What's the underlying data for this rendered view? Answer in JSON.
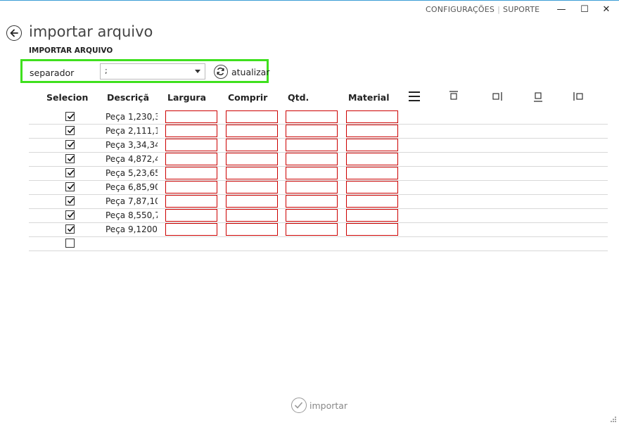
{
  "topnav": {
    "settings": "CONFIGURAÇÕES",
    "support": "SUPORTE",
    "separator": "|"
  },
  "window": {
    "minimize": "—",
    "maximize": "☐",
    "close": "✕"
  },
  "page": {
    "title": "importar arquivo",
    "subtitle": "IMPORTAR ARQUIVO"
  },
  "toolbar": {
    "separator_label": "separador",
    "separator_value": ";",
    "refresh_label": "atualizar"
  },
  "table": {
    "headers": {
      "select": "Selecion",
      "description": "Descriçã",
      "width": "Largura",
      "length": "Comprir",
      "qty": "Qtd.",
      "material": "Material"
    },
    "rows": [
      {
        "checked": true,
        "desc": "Peça 1,230,3"
      },
      {
        "checked": true,
        "desc": "Peça 2,111,1"
      },
      {
        "checked": true,
        "desc": "Peça 3,34,34"
      },
      {
        "checked": true,
        "desc": "Peça 4,872,4"
      },
      {
        "checked": true,
        "desc": "Peça 5,23,65"
      },
      {
        "checked": true,
        "desc": "Peça 6,85,90"
      },
      {
        "checked": true,
        "desc": "Peça 7,87,10"
      },
      {
        "checked": true,
        "desc": "Peça 8,550,7"
      },
      {
        "checked": true,
        "desc": "Peça 9,1200,"
      },
      {
        "checked": false,
        "desc": ""
      }
    ]
  },
  "footer": {
    "import_label": "importar"
  },
  "colors": {
    "accent": "#3fe01e",
    "error_border": "#cc0000",
    "topline": "#3c9dd6"
  }
}
